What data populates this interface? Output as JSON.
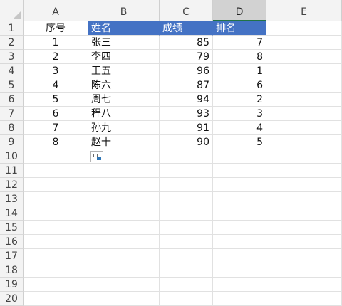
{
  "columns": [
    {
      "letter": "A"
    },
    {
      "letter": "B"
    },
    {
      "letter": "C"
    },
    {
      "letter": "D"
    },
    {
      "letter": "E"
    }
  ],
  "selected_column": "D",
  "row_numbers": [
    "1",
    "2",
    "3",
    "4",
    "5",
    "6",
    "7",
    "8",
    "9",
    "10",
    "11",
    "12",
    "13",
    "14",
    "15",
    "16",
    "17",
    "18",
    "19",
    "20"
  ],
  "header_row": {
    "a": "序号",
    "b": "姓名",
    "c": "成绩",
    "d": "排名"
  },
  "data_rows": [
    {
      "a": "1",
      "b": "张三",
      "c": "85",
      "d": "7"
    },
    {
      "a": "2",
      "b": "李四",
      "c": "79",
      "d": "8"
    },
    {
      "a": "3",
      "b": "王五",
      "c": "96",
      "d": "1"
    },
    {
      "a": "4",
      "b": "陈六",
      "c": "87",
      "d": "6"
    },
    {
      "a": "5",
      "b": "周七",
      "c": "94",
      "d": "2"
    },
    {
      "a": "6",
      "b": "程八",
      "c": "93",
      "d": "3"
    },
    {
      "a": "7",
      "b": "孙九",
      "c": "91",
      "d": "4"
    },
    {
      "a": "8",
      "b": "赵十",
      "c": "90",
      "d": "5"
    }
  ],
  "colors": {
    "header_fill": "#4472c4",
    "header_text": "#ffffff",
    "grid": "#e1e1e1",
    "heading_bg": "#f3f3f3",
    "selected_heading_bg": "#d2d2d2"
  },
  "paste_options_icon": "paste-options-icon"
}
